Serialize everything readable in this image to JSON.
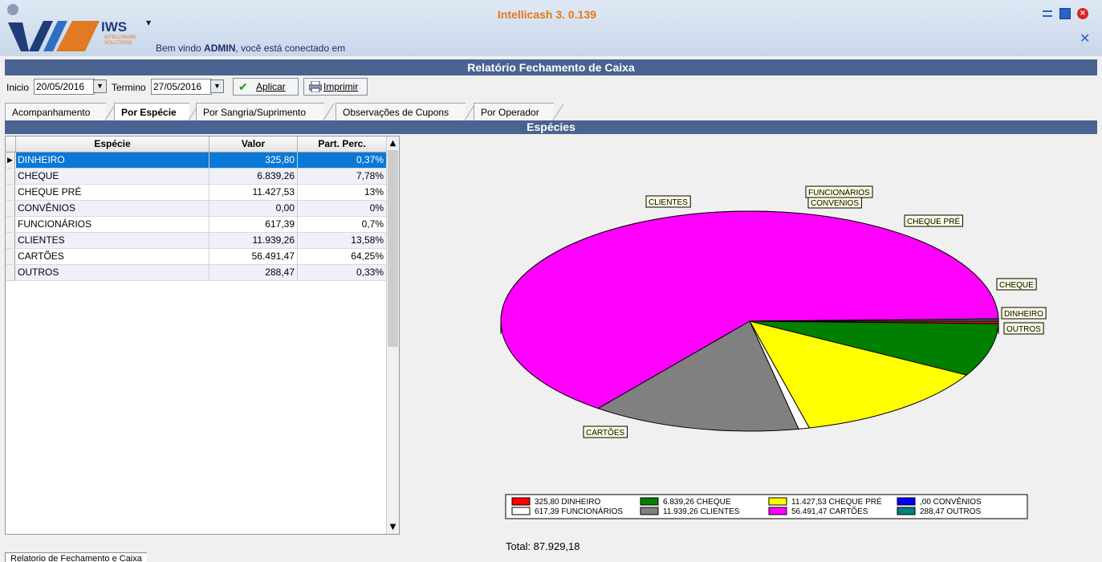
{
  "app": {
    "title": "Intellicash 3. 0.139",
    "welcome_prefix": "Bem vindo",
    "welcome_user": "ADMIN",
    "welcome_suffix": ", você está conectado em",
    "logo_text": "IWS",
    "logo_sub1": "INTELLIWARE",
    "logo_sub2": "SOLUTIONS"
  },
  "report": {
    "title": "Relatório Fechamento de Caixa",
    "section_title": "Espécies"
  },
  "filters": {
    "inicio_label": "Inicio",
    "inicio_value": "20/05/2016",
    "termino_label": "Termino",
    "termino_value": "27/05/2016",
    "aplicar_label": "Aplicar",
    "imprimir_label": "Imprimir"
  },
  "tabs": [
    "Acompanhamento",
    "Por Espécie",
    "Por Sangria/Suprimento",
    "Observações de Cupons",
    "Por Operador"
  ],
  "active_tab": "Por Espécie",
  "grid": {
    "headers": [
      "Espécie",
      "Valor",
      "Part. Perc."
    ],
    "rows": [
      {
        "especie": "DINHEIRO",
        "valor": "325,80",
        "perc": "0,37%"
      },
      {
        "especie": "CHEQUE",
        "valor": "6.839,26",
        "perc": "7,78%"
      },
      {
        "especie": "CHEQUE PRÉ",
        "valor": "11.427,53",
        "perc": "13%"
      },
      {
        "especie": "CONVÊNIOS",
        "valor": "0,00",
        "perc": "0%"
      },
      {
        "especie": "FUNCIONÁRIOS",
        "valor": "617,39",
        "perc": "0,7%"
      },
      {
        "especie": "CLIENTES",
        "valor": "11.939,26",
        "perc": "13,58%"
      },
      {
        "especie": "CARTÕES",
        "valor": "56.491,47",
        "perc": "64,25%"
      },
      {
        "especie": "OUTROS",
        "valor": "288,47",
        "perc": "0,33%"
      }
    ]
  },
  "chart_data": {
    "type": "pie",
    "categories": [
      "DINHEIRO",
      "CHEQUE",
      "CHEQUE PRÉ",
      "CONVÊNIOS",
      "FUNCIONÁRIOS",
      "CLIENTES",
      "CARTÕES",
      "OUTROS"
    ],
    "values": [
      325.8,
      6839.26,
      11427.53,
      0.0,
      617.39,
      11939.26,
      56491.47,
      288.47
    ],
    "slice_labels": [
      "DINHEIRO",
      "CHEQUE",
      "CHEQUE PRÉ",
      "CONVENIOS",
      "FUNCIONÁRIOS",
      "CLIENTES",
      "CARTÕES",
      "OUTROS"
    ],
    "colors": [
      "#ff0000",
      "#007f00",
      "#ffff00",
      "#0000ff",
      "#ffffff",
      "#808080",
      "#ff00ff",
      "#008080"
    ],
    "legend": [
      {
        "value": "325,80",
        "label": "DINHEIRO"
      },
      {
        "value": "6.839,26",
        "label": "CHEQUE"
      },
      {
        "value": "11.427,53",
        "label": "CHEQUE PRÉ"
      },
      {
        "value": ",00",
        "label": "CONVÊNIOS"
      },
      {
        "value": "617,39",
        "label": "FUNCIONÁRIOS"
      },
      {
        "value": "11.939,26",
        "label": "CLIENTES"
      },
      {
        "value": "56.491,47",
        "label": "CARTÕES"
      },
      {
        "value": "288,47",
        "label": "OUTROS"
      }
    ],
    "legend_placement": "bottom",
    "total_label": "Total: 87.929,18"
  },
  "bottom_tab": "Relatorio de Fechamento e Caixa"
}
